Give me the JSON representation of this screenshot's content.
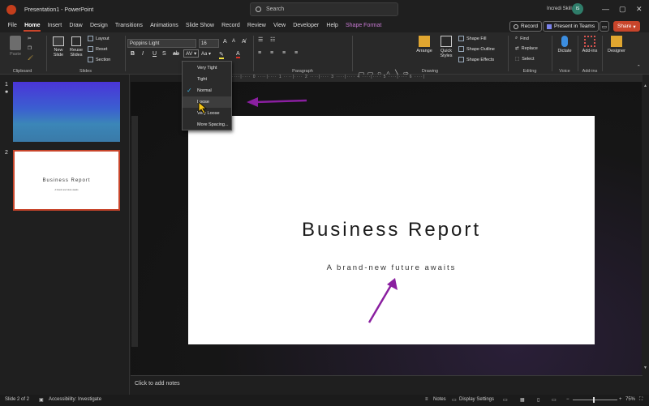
{
  "titlebar": {
    "doc_title": "Presentation1 - PowerPoint",
    "search_placeholder": "Search",
    "user_name": "Incredi Skill",
    "user_initials": "IS"
  },
  "menu": {
    "tabs": [
      "File",
      "Home",
      "Insert",
      "Draw",
      "Design",
      "Transitions",
      "Animations",
      "Slide Show",
      "Record",
      "Review",
      "View",
      "Developer",
      "Help",
      "Shape Format"
    ],
    "active": "Home",
    "record_btn": "Record",
    "present_btn": "Present in Teams",
    "share_btn": "Share"
  },
  "ribbon": {
    "clipboard": {
      "paste": "Paste",
      "label": "Clipboard"
    },
    "slides": {
      "new_slide": "New Slide",
      "reuse": "Reuse Slides",
      "layout": "Layout",
      "reset": "Reset",
      "section": "Section",
      "label": "Slides"
    },
    "font": {
      "name": "Poppins Light",
      "size": "16"
    },
    "paragraph": {
      "label": "Paragraph"
    },
    "drawing": {
      "arrange": "Arrange",
      "quick_styles": "Quick Styles",
      "shape_fill": "Shape Fill",
      "shape_outline": "Shape Outline",
      "shape_effects": "Shape Effects",
      "label": "Drawing"
    },
    "editing": {
      "find": "Find",
      "replace": "Replace",
      "select": "Select",
      "label": "Editing"
    },
    "voice": {
      "dictate": "Dictate",
      "label": "Voice"
    },
    "addins": {
      "addins": "Add-ins",
      "label": "Add-ins"
    },
    "designer": {
      "designer": "Designer"
    }
  },
  "char_spacing_menu": {
    "items": [
      "Very Tight",
      "Tight",
      "Normal",
      "Loose",
      "Very Loose",
      "More Spacing..."
    ],
    "checked": "Normal"
  },
  "thumbnails": [
    {
      "number": "1"
    },
    {
      "number": "2",
      "title": "Business Report",
      "subtitle": "A brand-new future awaits"
    }
  ],
  "slide": {
    "title": "Business Report",
    "subtitle": "A brand-new future awaits"
  },
  "notes_placeholder": "Click to add notes",
  "status": {
    "slide_info": "Slide 2 of 2",
    "accessibility": "Accessibility: Investigate",
    "notes": "Notes",
    "display_settings": "Display Settings",
    "zoom": "75%"
  },
  "colors": {
    "accent": "#c8452b",
    "annotation_arrow": "#8a1fa0",
    "check": "#3fb0e0"
  }
}
